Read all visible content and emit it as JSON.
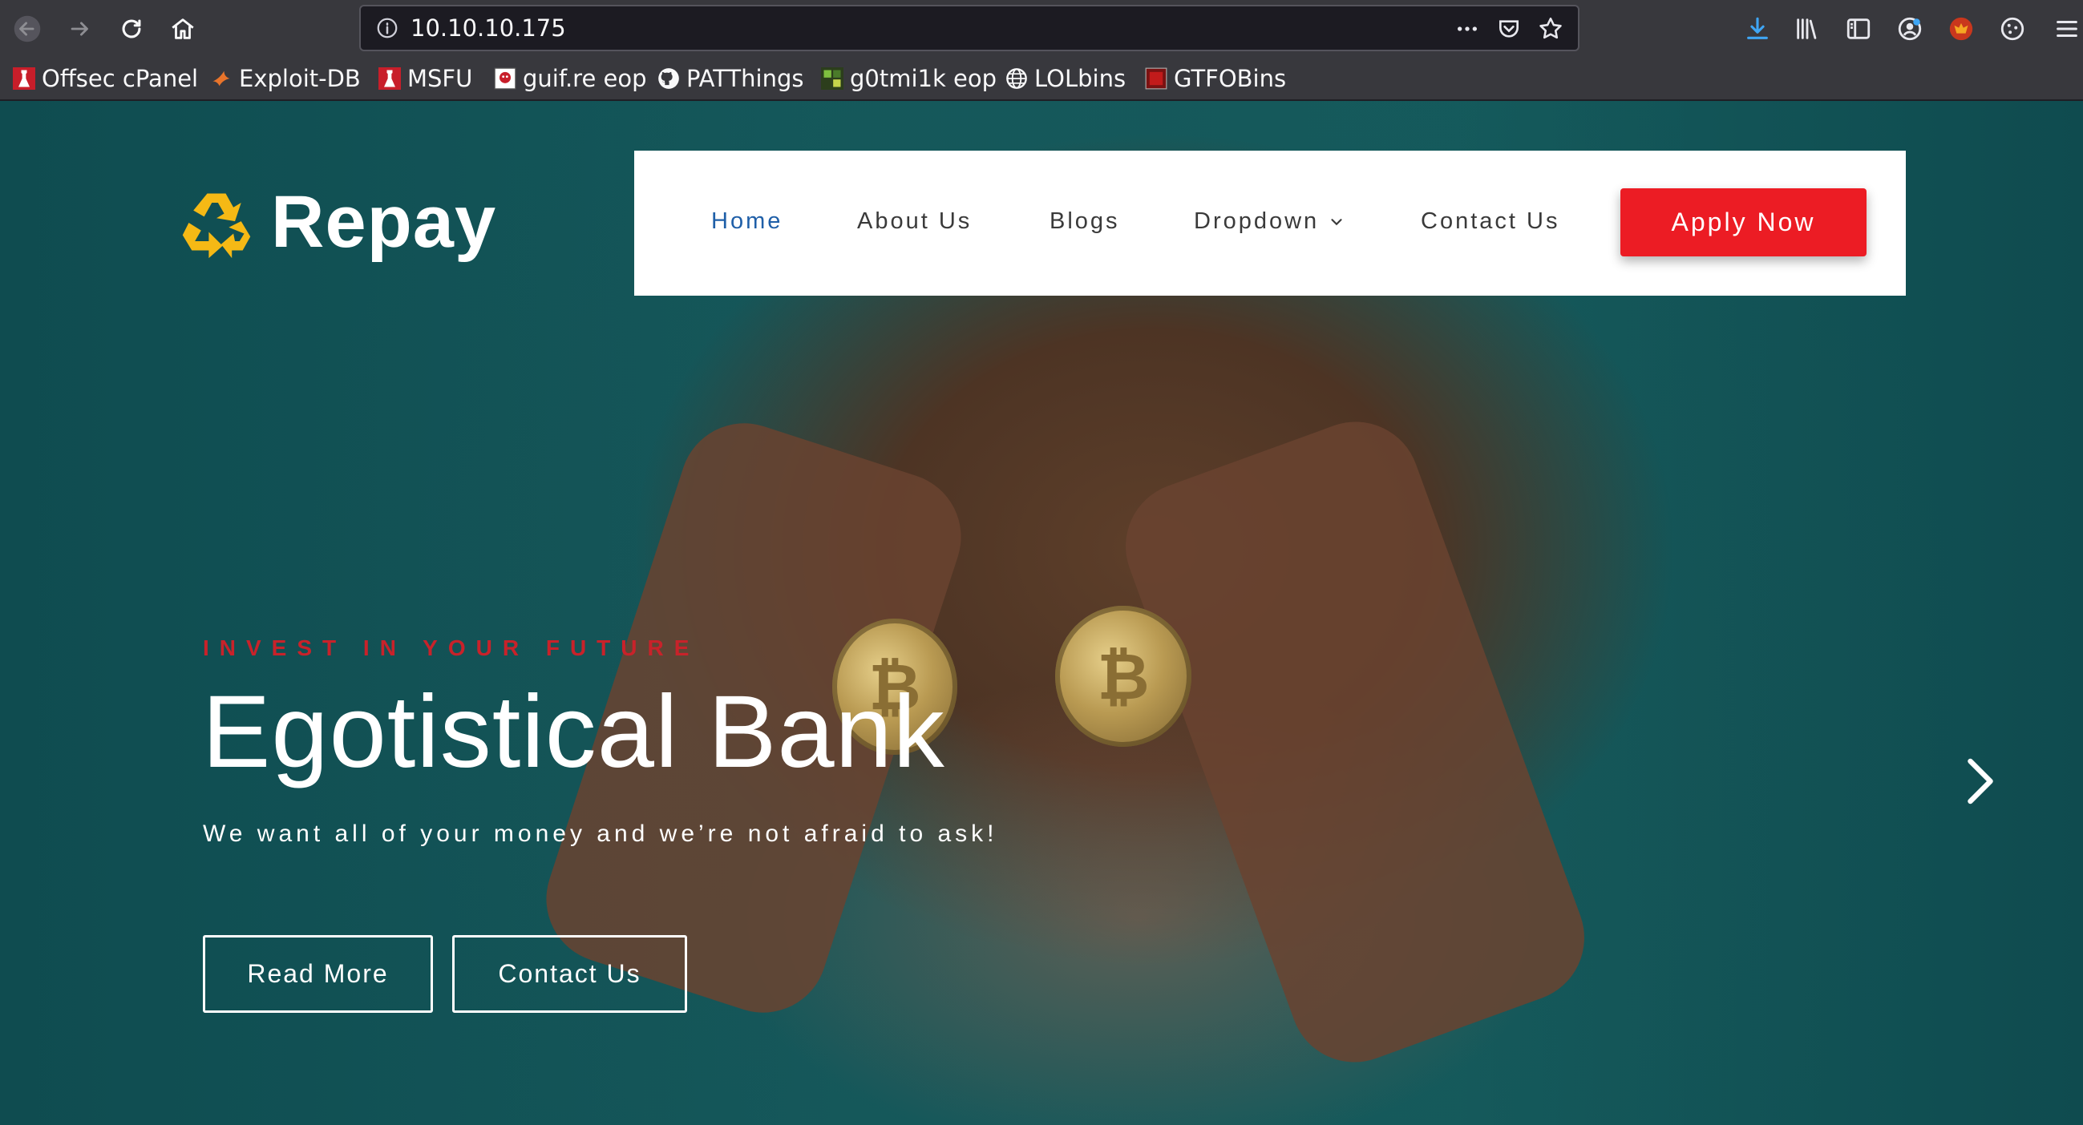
{
  "browser": {
    "url": "10.10.10.175",
    "bookmarks": [
      {
        "label": "Offsec cPanel",
        "icon": "offsec-icon"
      },
      {
        "label": "Exploit-DB",
        "icon": "exploitdb-icon"
      },
      {
        "label": "MSFU",
        "icon": "offsec-icon"
      },
      {
        "label": "guif.re eop",
        "icon": "guifre-icon"
      },
      {
        "label": "PATThings",
        "icon": "github-icon"
      },
      {
        "label": "g0tmi1k eop",
        "icon": "g0tmi1k-icon"
      },
      {
        "label": "LOLbins",
        "icon": "globe-icon"
      },
      {
        "label": "GTFOBins",
        "icon": "gtfobins-icon"
      }
    ]
  },
  "site": {
    "logo_text": "Repay",
    "nav": {
      "items": [
        "Home",
        "About Us",
        "Blogs",
        "Dropdown",
        "Contact Us"
      ],
      "active": "Home",
      "cta": "Apply Now"
    },
    "hero": {
      "eyebrow": "INVEST IN YOUR FUTURE",
      "title": "Egotistical Bank",
      "subtitle": "We want all of your money and we’re not afraid to ask!",
      "buttons": [
        "Read More",
        "Contact Us"
      ]
    }
  },
  "colors": {
    "accent_red": "#ec1c24",
    "nav_active": "#1f5fa8",
    "hero_bg": "#14585b",
    "logo_yellow": "#f5b915"
  }
}
